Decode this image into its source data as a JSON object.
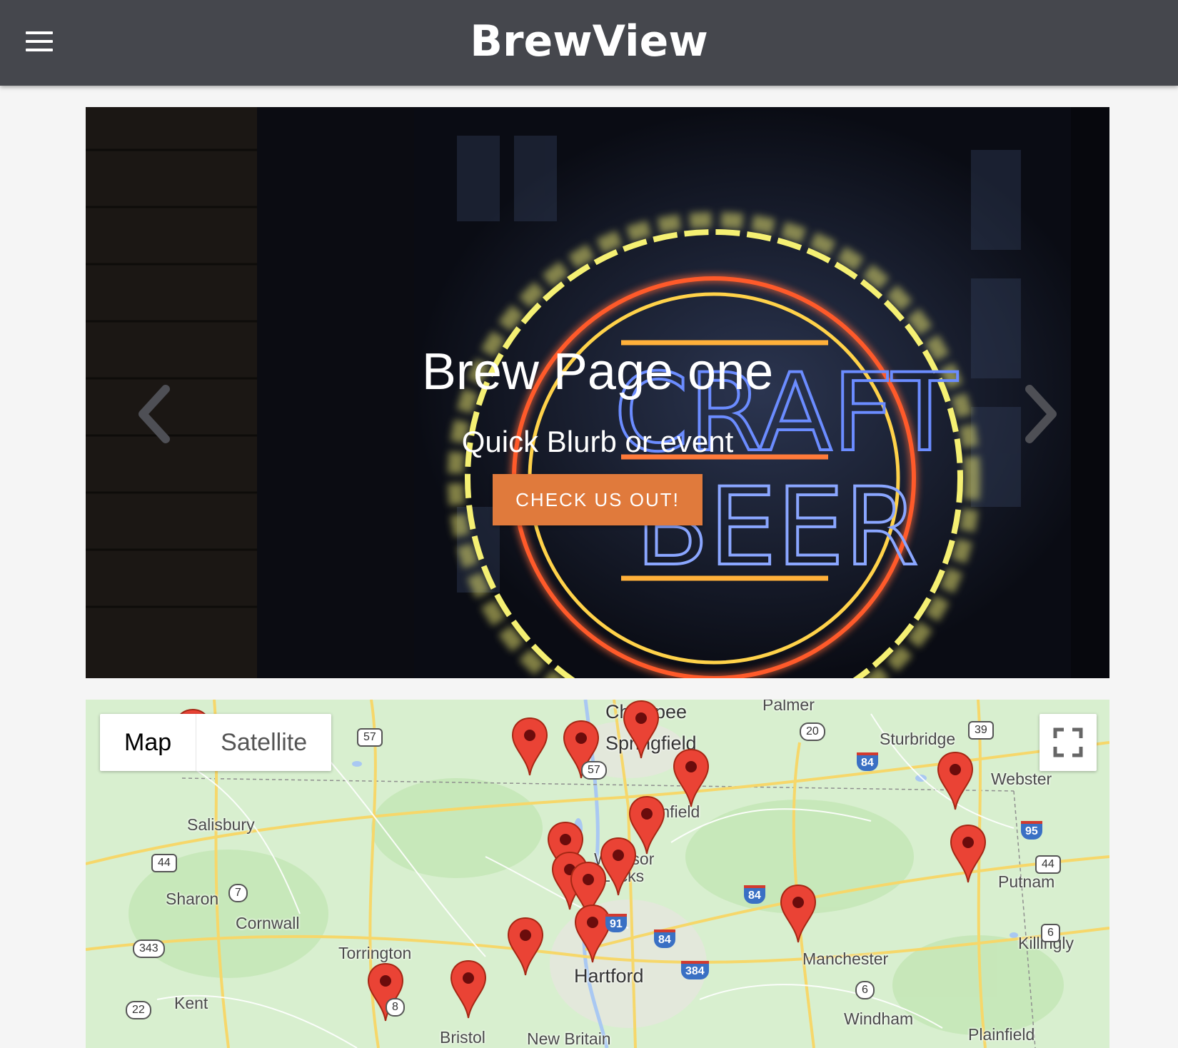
{
  "header": {
    "title": "BrewView",
    "menu_icon": "hamburger-menu-icon"
  },
  "hero": {
    "title": "Brew Page one",
    "subtitle": "Quick Blurb or event",
    "cta_label": "CHECK US OUT!",
    "image_alt_sign": [
      "CRAFT",
      "BEER"
    ],
    "prev_icon": "chevron-left-icon",
    "next_icon": "chevron-right-icon",
    "accent_color": "#e07a3c"
  },
  "map": {
    "type_options": [
      "Map",
      "Satellite"
    ],
    "selected_type": "Map",
    "fullscreen_icon": "fullscreen-icon",
    "places": [
      "Chicopee",
      "Palmer",
      "Springfield",
      "Sturbridge",
      "Webster",
      "Salisbury",
      "Enfield",
      "Windsor",
      "Locks",
      "Sharon",
      "Cornwall",
      "Putnam",
      "Torrington",
      "Killingly",
      "Manchester",
      "Hartford",
      "Kent",
      "Windham",
      "Bristol",
      "New Britain",
      "Plainfield"
    ],
    "route_shields": [
      "57",
      "20",
      "39",
      "84",
      "57",
      "44",
      "95",
      "44",
      "7",
      "91",
      "84",
      "343",
      "84",
      "6",
      "384",
      "6",
      "8",
      "22"
    ],
    "marker_count": 17,
    "marker_color": "#ea4335"
  }
}
